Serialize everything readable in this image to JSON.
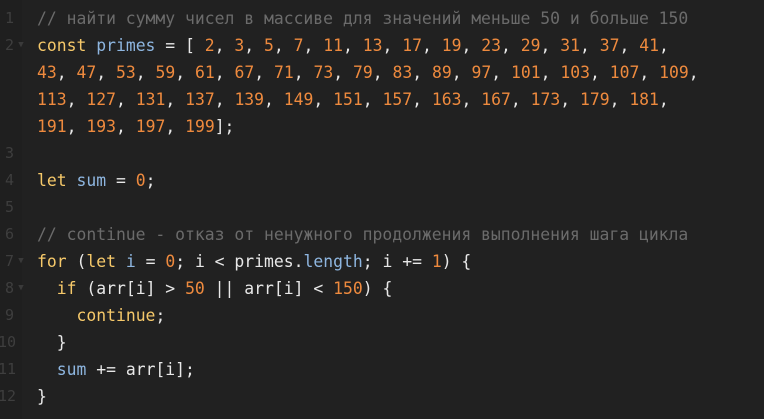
{
  "editor": {
    "colors": {
      "background": "#212121",
      "comment": "#6b6b6b",
      "keyword": "#f6c96a",
      "variable": "#8eb6e0",
      "number": "#ee8a3e",
      "text": "#e8e8e8",
      "gutter_text": "#3e3e3e"
    },
    "fold_marker_icon": "fold-arrow-icon",
    "lines": [
      {
        "no": "1",
        "fold": false,
        "wrapped": false,
        "tokens": [
          {
            "t": "// найти сумму чисел в массиве для значений меньше 50 и больше 150",
            "c": "comment"
          }
        ]
      },
      {
        "no": "2",
        "fold": true,
        "wrapped": false,
        "tokens": [
          {
            "t": "const",
            "c": "keyword"
          },
          {
            "t": " ",
            "c": "plain"
          },
          {
            "t": "primes",
            "c": "var"
          },
          {
            "t": " = [ ",
            "c": "punct"
          },
          {
            "t": "2",
            "c": "num"
          },
          {
            "t": ", ",
            "c": "punct"
          },
          {
            "t": "3",
            "c": "num"
          },
          {
            "t": ", ",
            "c": "punct"
          },
          {
            "t": "5",
            "c": "num"
          },
          {
            "t": ", ",
            "c": "punct"
          },
          {
            "t": "7",
            "c": "num"
          },
          {
            "t": ", ",
            "c": "punct"
          },
          {
            "t": "11",
            "c": "num"
          },
          {
            "t": ", ",
            "c": "punct"
          },
          {
            "t": "13",
            "c": "num"
          },
          {
            "t": ", ",
            "c": "punct"
          },
          {
            "t": "17",
            "c": "num"
          },
          {
            "t": ", ",
            "c": "punct"
          },
          {
            "t": "19",
            "c": "num"
          },
          {
            "t": ", ",
            "c": "punct"
          },
          {
            "t": "23",
            "c": "num"
          },
          {
            "t": ", ",
            "c": "punct"
          },
          {
            "t": "29",
            "c": "num"
          },
          {
            "t": ", ",
            "c": "punct"
          },
          {
            "t": "31",
            "c": "num"
          },
          {
            "t": ", ",
            "c": "punct"
          },
          {
            "t": "37",
            "c": "num"
          },
          {
            "t": ", ",
            "c": "punct"
          },
          {
            "t": "41",
            "c": "num"
          },
          {
            "t": ",",
            "c": "punct"
          }
        ]
      },
      {
        "no": "",
        "fold": false,
        "wrapped": true,
        "tokens": [
          {
            "t": "43",
            "c": "num"
          },
          {
            "t": ", ",
            "c": "punct"
          },
          {
            "t": "47",
            "c": "num"
          },
          {
            "t": ", ",
            "c": "punct"
          },
          {
            "t": "53",
            "c": "num"
          },
          {
            "t": ", ",
            "c": "punct"
          },
          {
            "t": "59",
            "c": "num"
          },
          {
            "t": ", ",
            "c": "punct"
          },
          {
            "t": "61",
            "c": "num"
          },
          {
            "t": ", ",
            "c": "punct"
          },
          {
            "t": "67",
            "c": "num"
          },
          {
            "t": ", ",
            "c": "punct"
          },
          {
            "t": "71",
            "c": "num"
          },
          {
            "t": ", ",
            "c": "punct"
          },
          {
            "t": "73",
            "c": "num"
          },
          {
            "t": ", ",
            "c": "punct"
          },
          {
            "t": "79",
            "c": "num"
          },
          {
            "t": ", ",
            "c": "punct"
          },
          {
            "t": "83",
            "c": "num"
          },
          {
            "t": ", ",
            "c": "punct"
          },
          {
            "t": "89",
            "c": "num"
          },
          {
            "t": ", ",
            "c": "punct"
          },
          {
            "t": "97",
            "c": "num"
          },
          {
            "t": ", ",
            "c": "punct"
          },
          {
            "t": "101",
            "c": "num"
          },
          {
            "t": ", ",
            "c": "punct"
          },
          {
            "t": "103",
            "c": "num"
          },
          {
            "t": ", ",
            "c": "punct"
          },
          {
            "t": "107",
            "c": "num"
          },
          {
            "t": ", ",
            "c": "punct"
          },
          {
            "t": "109",
            "c": "num"
          },
          {
            "t": ",",
            "c": "punct"
          }
        ]
      },
      {
        "no": "",
        "fold": false,
        "wrapped": true,
        "tokens": [
          {
            "t": "113",
            "c": "num"
          },
          {
            "t": ", ",
            "c": "punct"
          },
          {
            "t": "127",
            "c": "num"
          },
          {
            "t": ", ",
            "c": "punct"
          },
          {
            "t": "131",
            "c": "num"
          },
          {
            "t": ", ",
            "c": "punct"
          },
          {
            "t": "137",
            "c": "num"
          },
          {
            "t": ", ",
            "c": "punct"
          },
          {
            "t": "139",
            "c": "num"
          },
          {
            "t": ", ",
            "c": "punct"
          },
          {
            "t": "149",
            "c": "num"
          },
          {
            "t": ", ",
            "c": "punct"
          },
          {
            "t": "151",
            "c": "num"
          },
          {
            "t": ", ",
            "c": "punct"
          },
          {
            "t": "157",
            "c": "num"
          },
          {
            "t": ", ",
            "c": "punct"
          },
          {
            "t": "163",
            "c": "num"
          },
          {
            "t": ", ",
            "c": "punct"
          },
          {
            "t": "167",
            "c": "num"
          },
          {
            "t": ", ",
            "c": "punct"
          },
          {
            "t": "173",
            "c": "num"
          },
          {
            "t": ", ",
            "c": "punct"
          },
          {
            "t": "179",
            "c": "num"
          },
          {
            "t": ", ",
            "c": "punct"
          },
          {
            "t": "181",
            "c": "num"
          },
          {
            "t": ",",
            "c": "punct"
          }
        ]
      },
      {
        "no": "",
        "fold": false,
        "wrapped": true,
        "tokens": [
          {
            "t": "191",
            "c": "num"
          },
          {
            "t": ", ",
            "c": "punct"
          },
          {
            "t": "193",
            "c": "num"
          },
          {
            "t": ", ",
            "c": "punct"
          },
          {
            "t": "197",
            "c": "num"
          },
          {
            "t": ", ",
            "c": "punct"
          },
          {
            "t": "199",
            "c": "num"
          },
          {
            "t": "];",
            "c": "punct"
          }
        ]
      },
      {
        "no": "3",
        "fold": false,
        "wrapped": false,
        "tokens": []
      },
      {
        "no": "4",
        "fold": false,
        "wrapped": false,
        "tokens": [
          {
            "t": "let",
            "c": "keyword"
          },
          {
            "t": " ",
            "c": "plain"
          },
          {
            "t": "sum",
            "c": "var"
          },
          {
            "t": " = ",
            "c": "punct"
          },
          {
            "t": "0",
            "c": "num"
          },
          {
            "t": ";",
            "c": "punct"
          }
        ]
      },
      {
        "no": "5",
        "fold": false,
        "wrapped": false,
        "tokens": []
      },
      {
        "no": "6",
        "fold": false,
        "wrapped": false,
        "tokens": [
          {
            "t": "// continue - отказ от ненужного продолжения выполнения шага цикла",
            "c": "comment"
          }
        ]
      },
      {
        "no": "7",
        "fold": true,
        "wrapped": false,
        "tokens": [
          {
            "t": "for",
            "c": "keyword"
          },
          {
            "t": " (",
            "c": "punct"
          },
          {
            "t": "let",
            "c": "keyword"
          },
          {
            "t": " ",
            "c": "plain"
          },
          {
            "t": "i",
            "c": "var"
          },
          {
            "t": " = ",
            "c": "punct"
          },
          {
            "t": "0",
            "c": "num"
          },
          {
            "t": "; i < ",
            "c": "punct"
          },
          {
            "t": "primes",
            "c": "plain"
          },
          {
            "t": ".",
            "c": "punct"
          },
          {
            "t": "length",
            "c": "var"
          },
          {
            "t": "; i += ",
            "c": "punct"
          },
          {
            "t": "1",
            "c": "num"
          },
          {
            "t": ") {",
            "c": "punct"
          }
        ]
      },
      {
        "no": "8",
        "fold": true,
        "wrapped": false,
        "tokens": [
          {
            "t": "  ",
            "c": "plain"
          },
          {
            "t": "if",
            "c": "keyword"
          },
          {
            "t": " (arr[i] > ",
            "c": "punct"
          },
          {
            "t": "50",
            "c": "num"
          },
          {
            "t": " || arr[i] < ",
            "c": "punct"
          },
          {
            "t": "150",
            "c": "num"
          },
          {
            "t": ") {",
            "c": "punct"
          }
        ]
      },
      {
        "no": "9",
        "fold": false,
        "wrapped": false,
        "tokens": [
          {
            "t": "    ",
            "c": "plain"
          },
          {
            "t": "continue",
            "c": "keyword"
          },
          {
            "t": ";",
            "c": "punct"
          }
        ]
      },
      {
        "no": "10",
        "fold": false,
        "wrapped": false,
        "tokens": [
          {
            "t": "  }",
            "c": "punct"
          }
        ]
      },
      {
        "no": "11",
        "fold": false,
        "wrapped": false,
        "tokens": [
          {
            "t": "  ",
            "c": "plain"
          },
          {
            "t": "sum",
            "c": "var"
          },
          {
            "t": " += arr[i];",
            "c": "punct"
          }
        ]
      },
      {
        "no": "12",
        "fold": false,
        "wrapped": false,
        "tokens": [
          {
            "t": "}",
            "c": "punct"
          }
        ]
      }
    ]
  }
}
